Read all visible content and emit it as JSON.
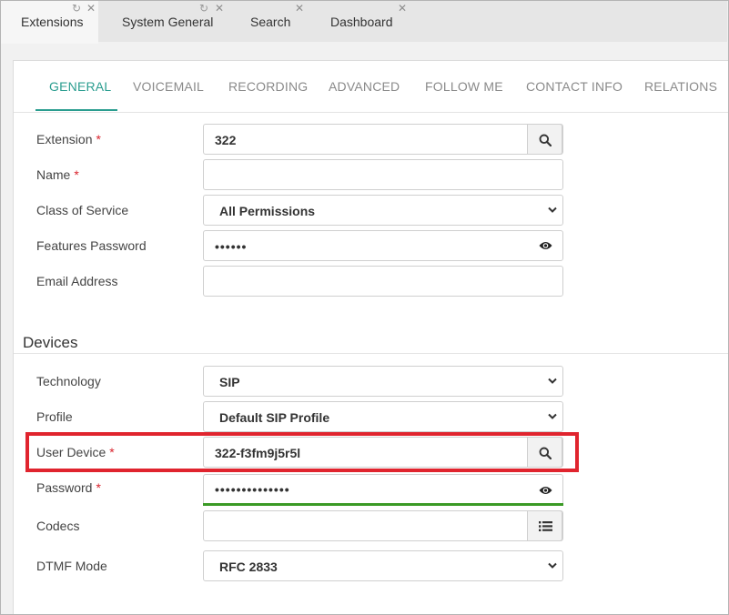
{
  "top_tabs": [
    {
      "label": "Extensions",
      "active": true
    },
    {
      "label": "System General",
      "active": false
    },
    {
      "label": "Search",
      "active": false
    },
    {
      "label": "Dashboard",
      "active": false
    }
  ],
  "sub_tabs": [
    "GENERAL",
    "VOICEMAIL",
    "RECORDING",
    "ADVANCED",
    "FOLLOW ME",
    "CONTACT INFO",
    "RELATIONS"
  ],
  "general": {
    "extension": {
      "label": "Extension",
      "value": "322",
      "required": "*"
    },
    "name": {
      "label": "Name",
      "value": "",
      "required": "*"
    },
    "class_of_service": {
      "label": "Class of Service",
      "value": "All Permissions"
    },
    "features_password": {
      "label": "Features Password",
      "value": "••••••"
    },
    "email": {
      "label": "Email Address",
      "value": ""
    }
  },
  "devices": {
    "title": "Devices",
    "technology": {
      "label": "Technology",
      "value": "SIP"
    },
    "profile": {
      "label": "Profile",
      "value": "Default SIP Profile"
    },
    "user_device": {
      "label": "User Device",
      "value": "322-f3fm9j5r5l",
      "required": "*"
    },
    "password": {
      "label": "Password",
      "value": "••••••••••••••",
      "required": "*"
    },
    "codecs": {
      "label": "Codecs",
      "value": ""
    },
    "dtmf_mode": {
      "label": "DTMF Mode",
      "value": "RFC 2833"
    }
  },
  "colors": {
    "accent": "#2a9d8f",
    "required": "#d9232d",
    "highlight": "#e0242e",
    "valid": "#3a9a25"
  }
}
